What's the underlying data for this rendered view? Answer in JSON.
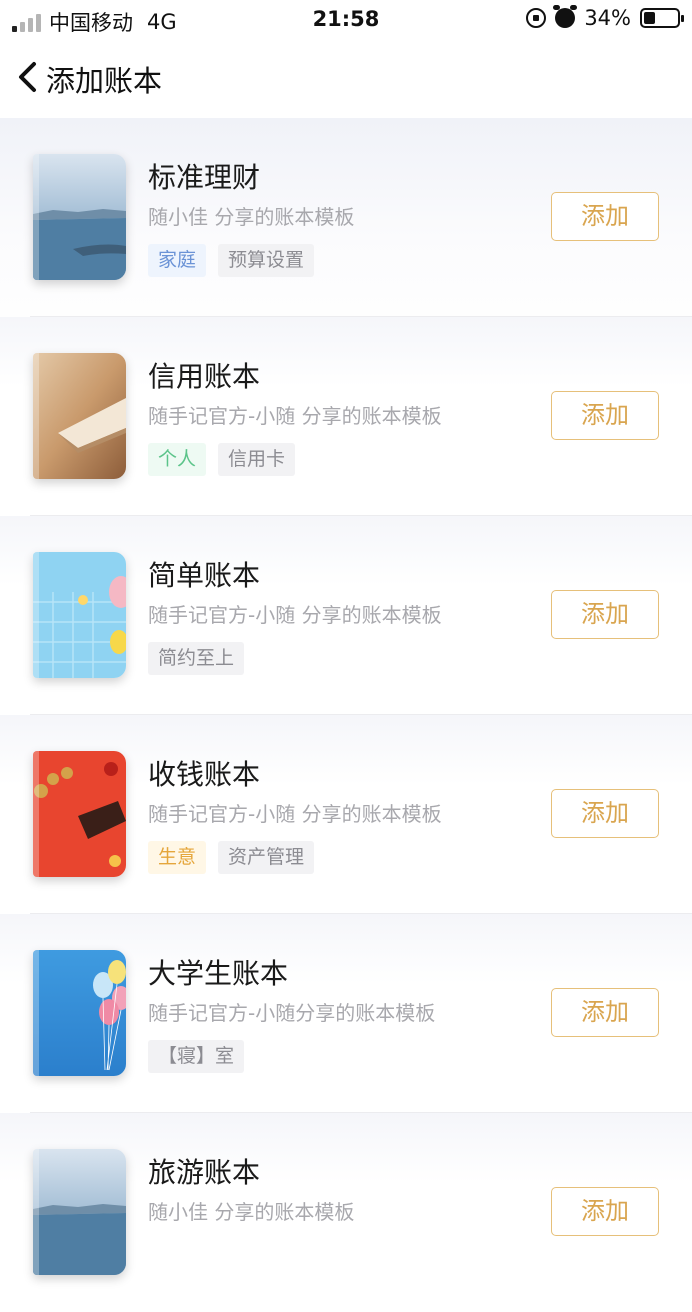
{
  "status_bar": {
    "carrier": "中国移动",
    "network": "4G",
    "time": "21:58",
    "battery": "34%",
    "battery_level": 0.34
  },
  "nav": {
    "title": "添加账本"
  },
  "books": [
    {
      "title": "标准理财",
      "subtitle": "随小佳 分享的账本模板",
      "tags": [
        {
          "label": "家庭",
          "style": "blue"
        },
        {
          "label": "预算设置",
          "style": "gray"
        }
      ],
      "add_label": "添加",
      "cover": "lake-icon"
    },
    {
      "title": "信用账本",
      "subtitle": "随手记官方-小随 分享的账本模板",
      "tags": [
        {
          "label": "个人",
          "style": "green"
        },
        {
          "label": "信用卡",
          "style": "gray"
        }
      ],
      "add_label": "添加",
      "cover": "card-icon"
    },
    {
      "title": "简单账本",
      "subtitle": "随手记官方-小随 分享的账本模板",
      "tags": [
        {
          "label": "简约至上",
          "style": "gray"
        }
      ],
      "add_label": "添加",
      "cover": "balloon-blue-icon"
    },
    {
      "title": "收钱账本",
      "subtitle": "随手记官方-小随 分享的账本模板",
      "tags": [
        {
          "label": "生意",
          "style": "yellow"
        },
        {
          "label": "资产管理",
          "style": "gray"
        }
      ],
      "add_label": "添加",
      "cover": "red-coins-icon"
    },
    {
      "title": "大学生账本",
      "subtitle": "随手记官方-小随分享的账本模板",
      "tags": [
        {
          "label": "【寝】室",
          "style": "gray"
        }
      ],
      "add_label": "添加",
      "cover": "balloons-icon"
    },
    {
      "title": "旅游账本",
      "subtitle": "随小佳 分享的账本模板",
      "tags": [],
      "add_label": "添加",
      "cover": "lake-icon"
    }
  ],
  "colors": {
    "accent": "#d9a54f",
    "tag_blue": "#6b93d6",
    "tag_green": "#5cc48a",
    "tag_yellow": "#e5a63b"
  }
}
